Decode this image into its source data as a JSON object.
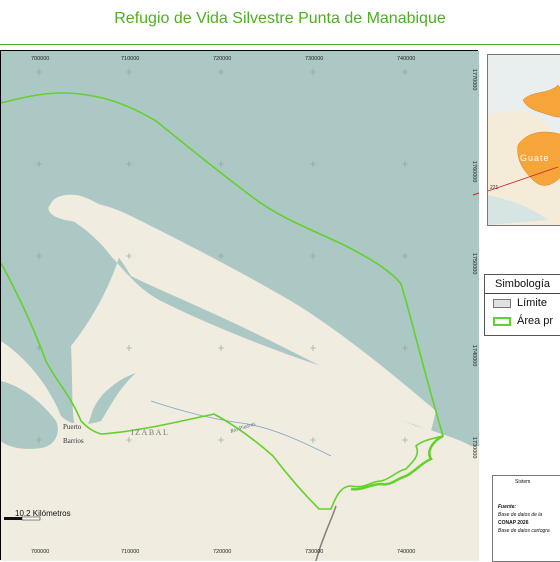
{
  "title": "Refugio de Vida Silvestre Punta de Manabique",
  "map": {
    "x_ticks": [
      "700000",
      "710000",
      "720000",
      "730000",
      "740000"
    ],
    "y_ticks": [
      "1770000",
      "1760000",
      "1750000",
      "1740000",
      "1730000"
    ],
    "labels": {
      "izabal": "IZABAL",
      "puerto_barrios_1": "Puerto",
      "puerto_barrios_2": "Barrios",
      "rio": "Río Piedras"
    },
    "colors": {
      "sea": "#abc8c5",
      "land": "#f0ecdf",
      "boundary": "#63d12c"
    }
  },
  "inset": {
    "label": "Guate",
    "number": "221"
  },
  "legend": {
    "title": "Simbología",
    "items": [
      {
        "label": "Límite",
        "swatch": "gray"
      },
      {
        "label": "Área pr",
        "swatch": "green"
      }
    ]
  },
  "scale": {
    "text": "10.2 Kilómetros"
  },
  "info": {
    "line1": "Sistem",
    "line2": "Fuente:",
    "line3": "Base de datos de la",
    "line4": "CONAP 2026",
    "line5": "Base de datos cartogra"
  }
}
